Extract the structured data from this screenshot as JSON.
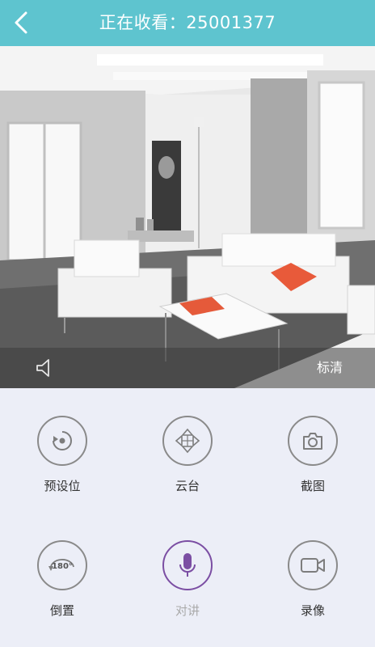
{
  "header": {
    "title": "正在收看：25001377",
    "back_icon": "chevron-left-icon"
  },
  "video": {
    "quality_label": "标清",
    "volume_icon": "speaker-icon"
  },
  "controls": [
    {
      "label": "预设位",
      "icon": "preset-position-icon",
      "state": "normal"
    },
    {
      "label": "云台",
      "icon": "ptz-direction-icon",
      "state": "normal"
    },
    {
      "label": "截图",
      "icon": "camera-icon",
      "state": "normal"
    },
    {
      "label": "倒置",
      "icon": "rotate-180-icon",
      "icon_text": "180°",
      "state": "normal"
    },
    {
      "label": "对讲",
      "icon": "microphone-icon",
      "state": "active"
    },
    {
      "label": "录像",
      "icon": "video-camera-icon",
      "state": "normal"
    }
  ],
  "colors": {
    "header": "#5ec4cf",
    "background": "#eceef7",
    "active": "#7b4ea3",
    "icon": "#8a8a8a"
  }
}
